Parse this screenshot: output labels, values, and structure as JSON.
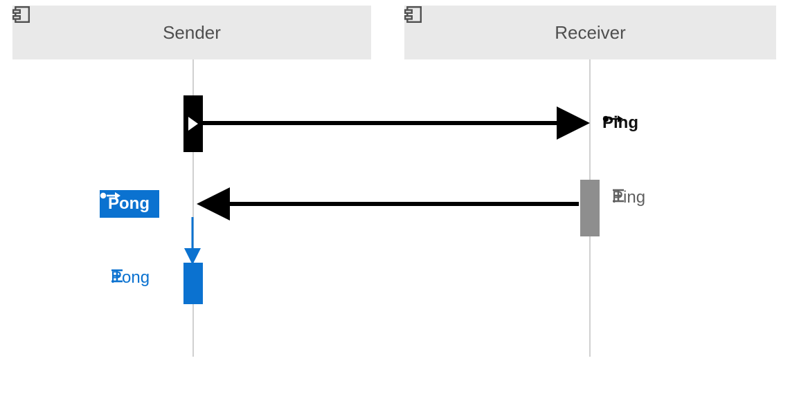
{
  "participants": {
    "sender": {
      "label": "Sender"
    },
    "receiver": {
      "label": "Receiver"
    }
  },
  "messages": {
    "ping_send": "Ping",
    "ping_recv": "Ping",
    "pong_send": "Pong",
    "pong_recv": "Pong"
  },
  "colors": {
    "header_bg": "#e9e9e9",
    "accent": "#0b72d0",
    "grey_act": "#8e8e8e"
  }
}
